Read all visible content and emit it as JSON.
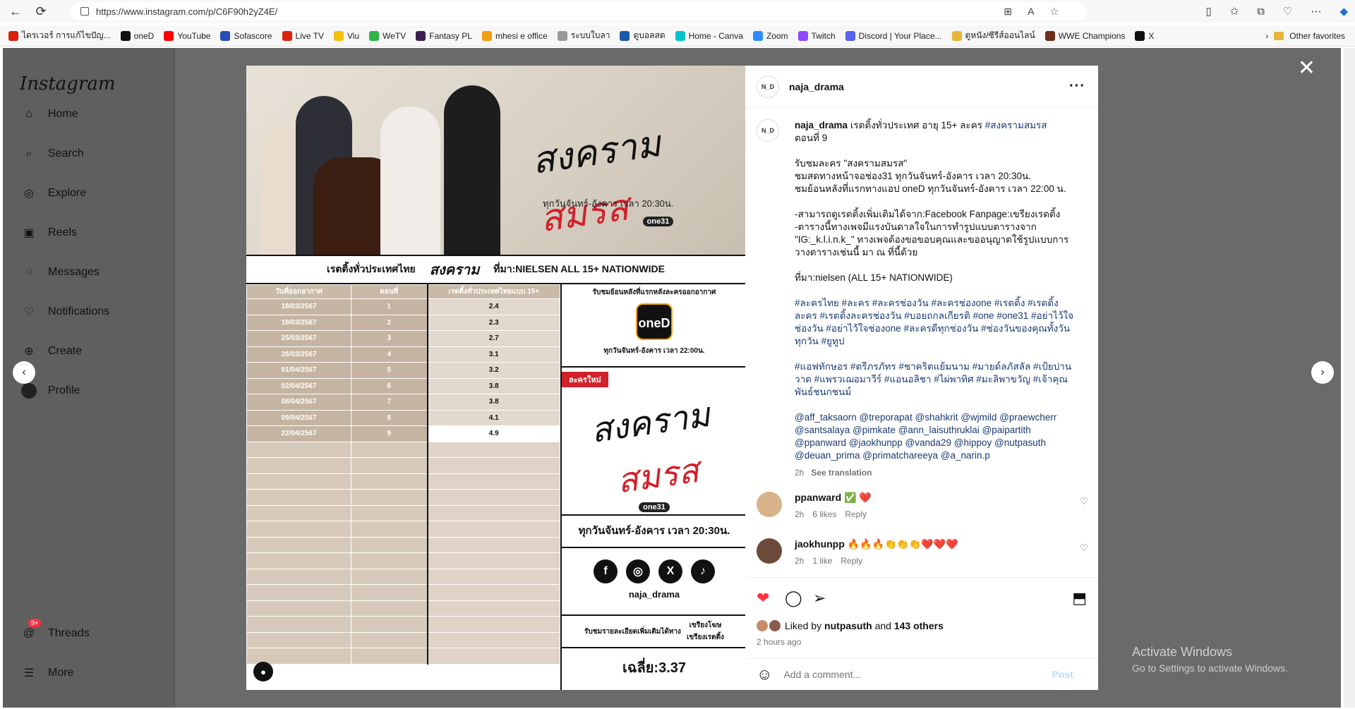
{
  "browser": {
    "url": "https://www.instagram.com/p/C6F90h2yZ4E/",
    "bookmarks": [
      "ไดรเวอร์ การแก้ไขปัญ...",
      "oneD",
      "YouTube",
      "Sofascore",
      "Live TV",
      "Viu",
      "WeTV",
      "Fantasy PL",
      "mhesi e office",
      "ระบบใบลา",
      "ดูบอลสด",
      "Home - Canva",
      "Zoom",
      "Twitch",
      "Discord | Your Place...",
      "ดูหนัง/ซีรีส์ออนไลน์",
      "WWE Champions",
      "X"
    ],
    "other_favorites": "Other favorites"
  },
  "sidebar": {
    "logo": "Instagram",
    "items": [
      {
        "label": "Home",
        "icon": "home-icon"
      },
      {
        "label": "Search",
        "icon": "search-icon"
      },
      {
        "label": "Explore",
        "icon": "compass-icon"
      },
      {
        "label": "Reels",
        "icon": "reels-icon"
      },
      {
        "label": "Messages",
        "icon": "messenger-icon"
      },
      {
        "label": "Notifications",
        "icon": "heart-icon"
      },
      {
        "label": "Create",
        "icon": "plus-icon"
      }
    ],
    "profile": "Profile",
    "threads": "Threads",
    "threads_badge": "9+",
    "more": "More"
  },
  "media": {
    "banner_title_1": "สงคราม",
    "banner_title_2": "สมรส",
    "banner_time": "ทุกวันจันทร์-อังคาร เวลา 20:30น.",
    "channel": "one31",
    "strip_left": "เรตติ้งทั่วประเทศไทย",
    "strip_right": "ที่มา:NIELSEN ALL 15+ NATIONWIDE",
    "table_headers": [
      "วันที่ออกอากาศ",
      "ตอนที่",
      "เรตติ้งทั่วประเทศไทยแบบ 15+"
    ],
    "rows": [
      [
        "18/03/2567",
        "1",
        "2.4"
      ],
      [
        "19/03/2567",
        "2",
        "2.3"
      ],
      [
        "25/03/2567",
        "3",
        "2.7"
      ],
      [
        "26/03/2567",
        "4",
        "3.1"
      ],
      [
        "01/04/2567",
        "5",
        "3.2"
      ],
      [
        "02/04/2567",
        "6",
        "3.8"
      ],
      [
        "08/04/2567",
        "7",
        "3.8"
      ],
      [
        "09/04/2567",
        "8",
        "4.1"
      ],
      [
        "22/04/2567",
        "9",
        "4.9"
      ]
    ],
    "rewatch_title": "รับชมย้อนหลังที่แรกหลังละครออกอากาศ",
    "oned_label": "oneD",
    "rewatch_time": "ทุกวันจันทร์-อังคาร เวลา 22:00น.",
    "new_tag": "ละครใหม่",
    "bottom_time": "ทุกวันจันทร์-อังคาร เวลา 20:30น.",
    "social_handle": "naja_drama",
    "details_label": "รับชมรายละเอียดเพิ่มเติมได้ทาง",
    "details_pages": [
      "เขรียงโฆษ",
      "เขรียงเรตติ้ง"
    ],
    "average": "เฉลี่ย:3.37"
  },
  "post": {
    "username": "naja_drama",
    "avatar_text": "N_D",
    "caption_line1": "เรตติ้งทั่วประเทศ อายุ 15+ ละคร",
    "caption_hashtag1": "#สงครามสมรส",
    "caption_line2": "ตอนที่ 9",
    "caption_block1": [
      "รับชมละคร \"สงครามสมรส\"",
      "ชมสดทางหน้าจอช่อง31 ทุกวันจันทร์-อังคาร เวลา 20:30น.",
      "ชมย้อนหลังที่แรกทางแอป oneD ทุกวันจันทร์-อังคาร เวลา 22:00 น."
    ],
    "caption_block2": [
      "-สามารถดูเรตติ้งเพิ่มเติมได้จาก:Facebook Fanpage:เขรียงเรตติ้ง",
      "-ตารางนี้ทางเพจมีแรงบันดาลใจในการทำรูปแบบตารางจาก",
      "\"IG:_k.l.i.n.k_\" ทางเพจต้องขอขอบคุณและขออนุญาตใช้รูปแบบการ",
      "วางตารางเช่นนี้ มา ณ ที่นี้ด้วย"
    ],
    "caption_source": "ที่มา:nielsen (ALL 15+ NATIONWIDE)",
    "hashtags_1": "#ละครไทย #ละคร #ละครช่องวัน #ละครช่องone #เรตติ้ง #เรตติ้งละคร #เรตติ้งละครช่องวัน #บอยถกลเกียรติ #one #one31 #อย่าไว้ใจช่องวัน #อย่าไว้ใจช่องone #ละครดีทุกช่องวัน #ช่องวันของคุณทั้งวันทุกวัน #ยูทูป",
    "hashtags_2": "#แอฟทักษอร #ตรีภรภัทร #ชาคริตแย้มนาม #มายด์ลภัสลัล #เป้ยปานวาด #แพรวเฌอมาวีร์ #แอนอลิชา #ไผ่พาทิศ #มะลิพาขวัญ #เจ้าคุณพันธ์ชนกชนม์",
    "mentions": "@aff_taksaorn @treporapat @shahkrit @wjmild @praewcherr @santsalaya @pimkate @ann_laisuthruklai @paipartith @ppanward @jaokhunpp @vanda29 @hippoy @nutpasuth @deuan_prima @primatchareeya @a_narin.p",
    "caption_time": "2h",
    "see_translation": "See translation",
    "comments": [
      {
        "user": "ppanward",
        "text": "✅ ❤️",
        "time": "2h",
        "likes": "6 likes",
        "reply": "Reply"
      },
      {
        "user": "jaokhunpp",
        "text": "🔥🔥🔥👏👏👏❤️❤️❤️",
        "time": "2h",
        "likes": "1 like",
        "reply": "Reply"
      }
    ],
    "liked_by_prefix": "Liked by",
    "liked_by_user": "nutpasuth",
    "liked_by_suffix": "and",
    "liked_by_others": "143 others",
    "time_ago": "2 hours ago",
    "add_comment_placeholder": "Add a comment...",
    "post_label": "Post"
  },
  "watermark": {
    "line1": "Activate Windows",
    "line2": "Go to Settings to activate Windows."
  }
}
